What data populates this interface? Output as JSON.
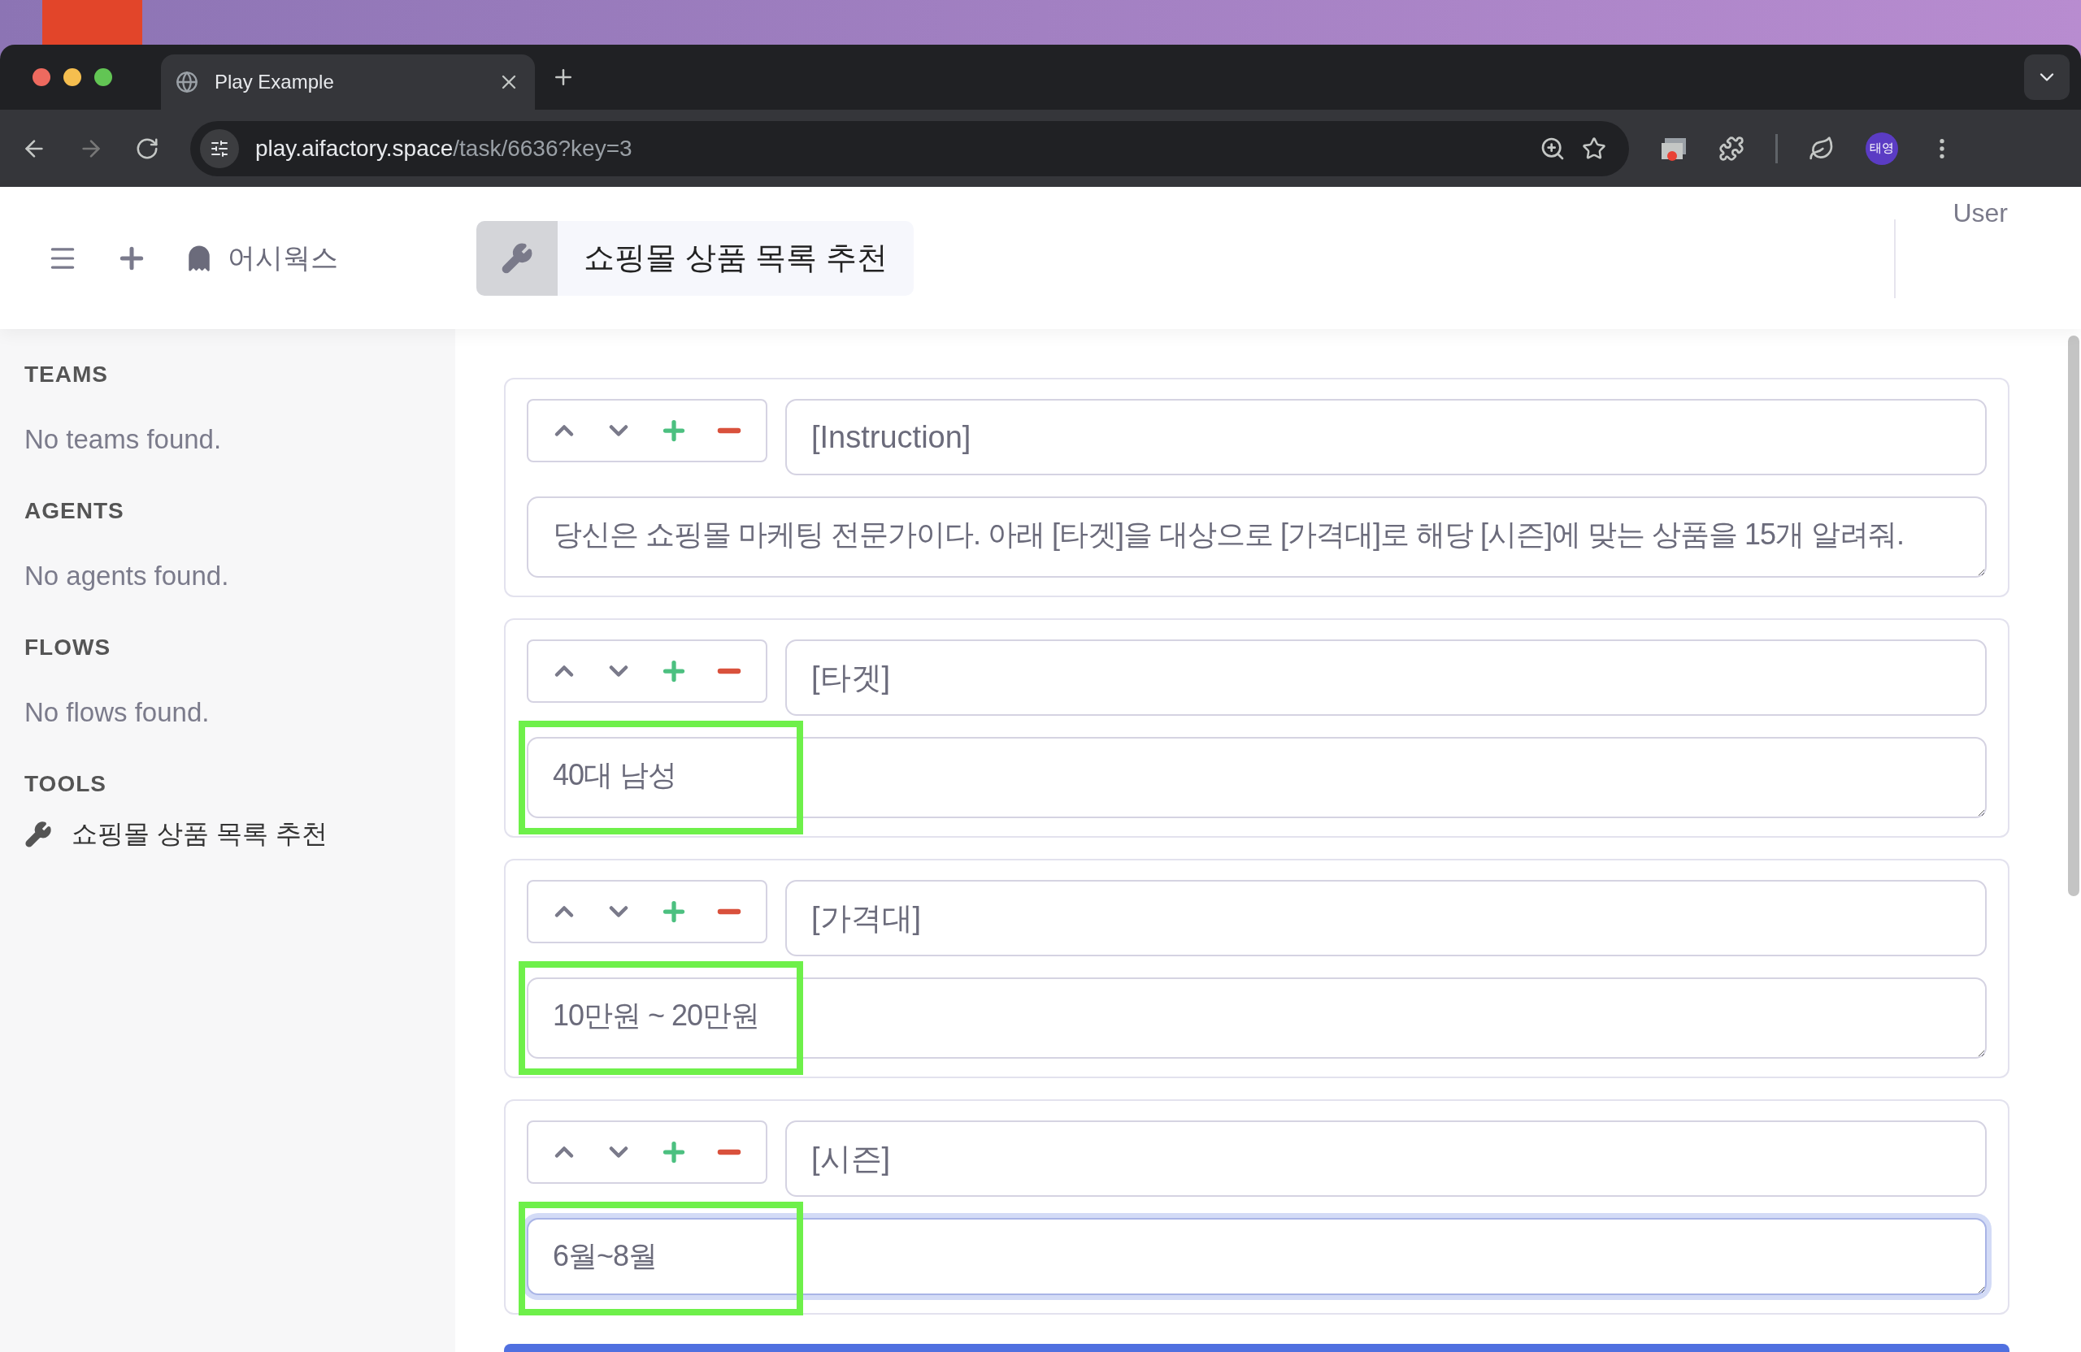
{
  "browser": {
    "tab_title": "Play Example",
    "url_host": "play.aifactory.space",
    "url_path": "/task/6636?key=3",
    "profile": "태영"
  },
  "header": {
    "brand": "어시웍스",
    "tool_title": "쇼핑몰 상품 목록 추천",
    "user": "User"
  },
  "sidebar": [
    {
      "heading": "TEAMS",
      "items": [
        {
          "kind": "empty",
          "label": "No teams found."
        }
      ]
    },
    {
      "heading": "AGENTS",
      "items": [
        {
          "kind": "empty",
          "label": "No agents found."
        }
      ]
    },
    {
      "heading": "FLOWS",
      "items": [
        {
          "kind": "empty",
          "label": "No flows found."
        }
      ]
    },
    {
      "heading": "TOOLS",
      "items": [
        {
          "kind": "tool",
          "label": "쇼핑몰 상품 목록 추천"
        }
      ]
    }
  ],
  "blocks": [
    {
      "title": "[Instruction]",
      "value": "당신은 쇼핑몰 마케팅 전문가이다. 아래 [타겟]을 대상으로 [가격대]로 해당 [시즌]에 맞는 상품을 15개 알려줘.",
      "highlighted": false,
      "focused": false
    },
    {
      "title": "[타겟]",
      "value": "40대 남성",
      "highlighted": true,
      "focused": false
    },
    {
      "title": "[가격대]",
      "value": "10만원 ~ 20만원",
      "highlighted": true,
      "focused": false
    },
    {
      "title": "[시즌]",
      "value": "6월~8월",
      "highlighted": true,
      "focused": true
    }
  ]
}
